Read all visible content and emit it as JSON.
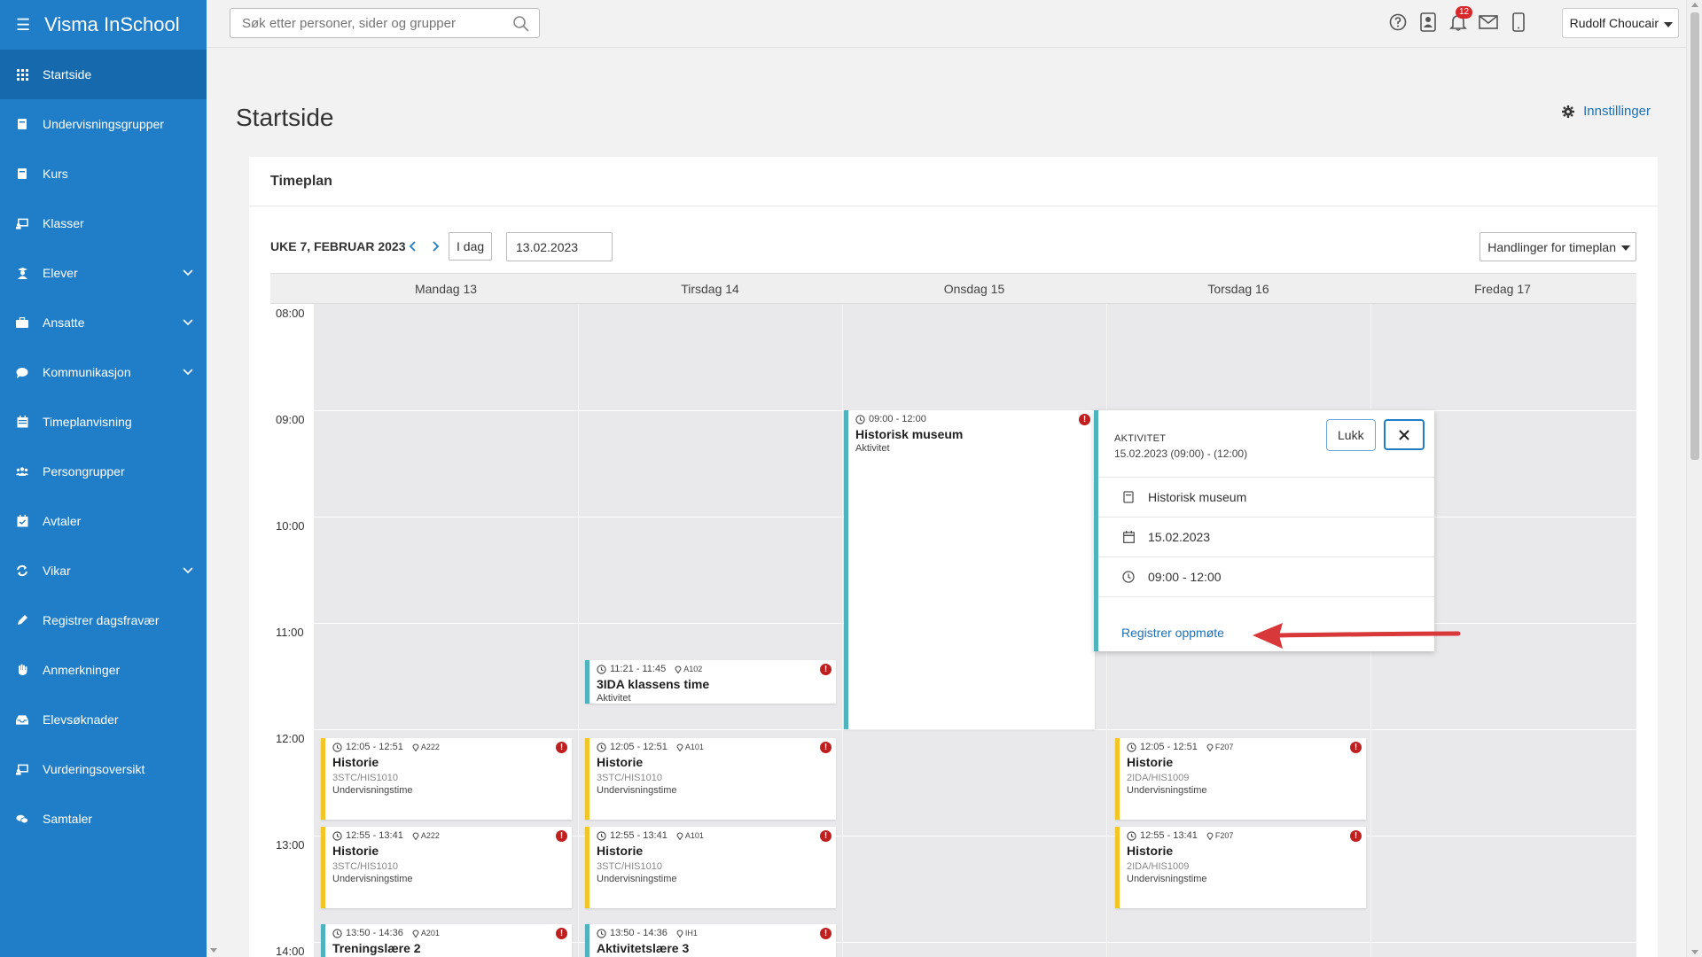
{
  "brand": "Visma InSchool",
  "sidebar": {
    "items": [
      {
        "label": "Startside",
        "icon": "grid-icon",
        "active": true
      },
      {
        "label": "Undervisningsgrupper",
        "icon": "book-icon"
      },
      {
        "label": "Kurs",
        "icon": "book-icon"
      },
      {
        "label": "Klasser",
        "icon": "classroom-icon"
      },
      {
        "label": "Elever",
        "icon": "student-icon",
        "expandable": true
      },
      {
        "label": "Ansatte",
        "icon": "briefcase-icon",
        "expandable": true
      },
      {
        "label": "Kommunikasjon",
        "icon": "chat-icon",
        "expandable": true
      },
      {
        "label": "Timeplanvisning",
        "icon": "calendar-icon"
      },
      {
        "label": "Persongrupper",
        "icon": "people-icon"
      },
      {
        "label": "Avtaler",
        "icon": "calendar-check-icon"
      },
      {
        "label": "Vikar",
        "icon": "refresh-icon",
        "expandable": true
      },
      {
        "label": "Registrer dagsfravær",
        "icon": "pencil-icon"
      },
      {
        "label": "Anmerkninger",
        "icon": "hand-icon"
      },
      {
        "label": "Elevsøknader",
        "icon": "inbox-icon"
      },
      {
        "label": "Vurderingsoversikt",
        "icon": "classroom-icon"
      },
      {
        "label": "Samtaler",
        "icon": "chat-icon"
      }
    ]
  },
  "topbar": {
    "search_placeholder": "Søk etter personer, sider og grupper",
    "notification_count": "12",
    "user_name": "Rudolf Choucair"
  },
  "page": {
    "title": "Startside",
    "settings_label": "Innstillinger"
  },
  "timetable": {
    "card_title": "Timeplan",
    "week_label": "UKE 7, FEBRUAR 2023",
    "today_label": "I dag",
    "date_value": "13.02.2023",
    "actions_label": "Handlinger for timeplan",
    "days": [
      "Mandag 13",
      "Tirsdag 14",
      "Onsdag 15",
      "Torsdag 16",
      "Fredag 17"
    ],
    "hours": [
      "08:00",
      "09:00",
      "10:00",
      "11:00",
      "12:00",
      "13:00",
      "14:00"
    ],
    "events": [
      {
        "time": "09:00 - 12:00",
        "room": "",
        "title": "Historisk museum",
        "code": "",
        "type": "Aktivitet"
      },
      {
        "time": "11:21 - 11:45",
        "room": "A102",
        "title": "3IDA klassens time",
        "code": "",
        "type": "Aktivitet"
      },
      {
        "time": "12:05 - 12:51",
        "room": "A222",
        "title": "Historie",
        "code": "3STC/HIS1010",
        "type": "Undervisningstime"
      },
      {
        "time": "12:05 - 12:51",
        "room": "A101",
        "title": "Historie",
        "code": "3STC/HIS1010",
        "type": "Undervisningstime"
      },
      {
        "time": "12:05 - 12:51",
        "room": "F207",
        "title": "Historie",
        "code": "2IDA/HIS1009",
        "type": "Undervisningstime"
      },
      {
        "time": "12:55 - 13:41",
        "room": "A222",
        "title": "Historie",
        "code": "3STC/HIS1010",
        "type": "Undervisningstime"
      },
      {
        "time": "12:55 - 13:41",
        "room": "A101",
        "title": "Historie",
        "code": "3STC/HIS1010",
        "type": "Undervisningstime"
      },
      {
        "time": "12:55 - 13:41",
        "room": "F207",
        "title": "Historie",
        "code": "2IDA/HIS1009",
        "type": "Undervisningstime"
      },
      {
        "time": "13:50 - 14:36",
        "room": "A201",
        "title": "Treningslære 2",
        "code": "",
        "type": ""
      },
      {
        "time": "13:50 - 14:36",
        "room": "IH1",
        "title": "Aktivitetslære 3",
        "code": "",
        "type": ""
      }
    ]
  },
  "popover": {
    "kicker": "AKTIVITET",
    "subtitle": "15.02.2023 (09:00) - (12:00)",
    "name": "Historisk museum",
    "date": "15.02.2023",
    "time": "09:00 - 12:00",
    "link": "Registrer oppmøte",
    "close_label": "Lukk"
  },
  "colors": {
    "sidebar": "#1f7ec7",
    "sidebar_active": "#1669ad",
    "lesson_accent": "#f2c626",
    "activity_accent": "#4eb3bf",
    "warning": "#c01f1f",
    "annotation_arrow": "#d9383a"
  }
}
